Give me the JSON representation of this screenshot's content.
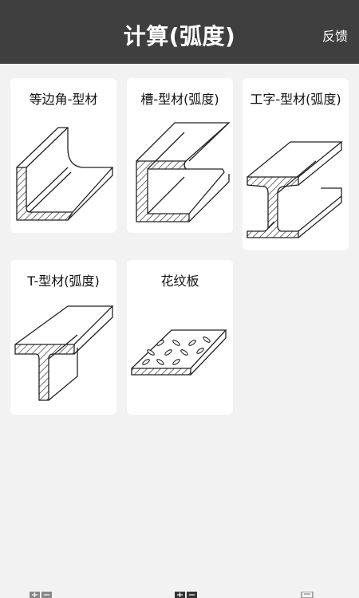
{
  "header": {
    "title": "计算(弧度)",
    "feedback_label": "反馈"
  },
  "cards": [
    {
      "label": "等边角-型材",
      "icon": "equal-angle-steel-icon"
    },
    {
      "label": "槽-型材(弧度)",
      "icon": "channel-steel-icon"
    },
    {
      "label": "工字-型材(弧度)",
      "icon": "i-beam-steel-icon"
    },
    {
      "label": "T-型材(弧度)",
      "icon": "t-bar-steel-icon"
    },
    {
      "label": "花纹板",
      "icon": "checker-plate-icon"
    }
  ],
  "bottom_tabs": [
    {
      "icon": "calculator-icon"
    },
    {
      "icon": "calculator-icon"
    },
    {
      "icon": "history-icon"
    }
  ]
}
